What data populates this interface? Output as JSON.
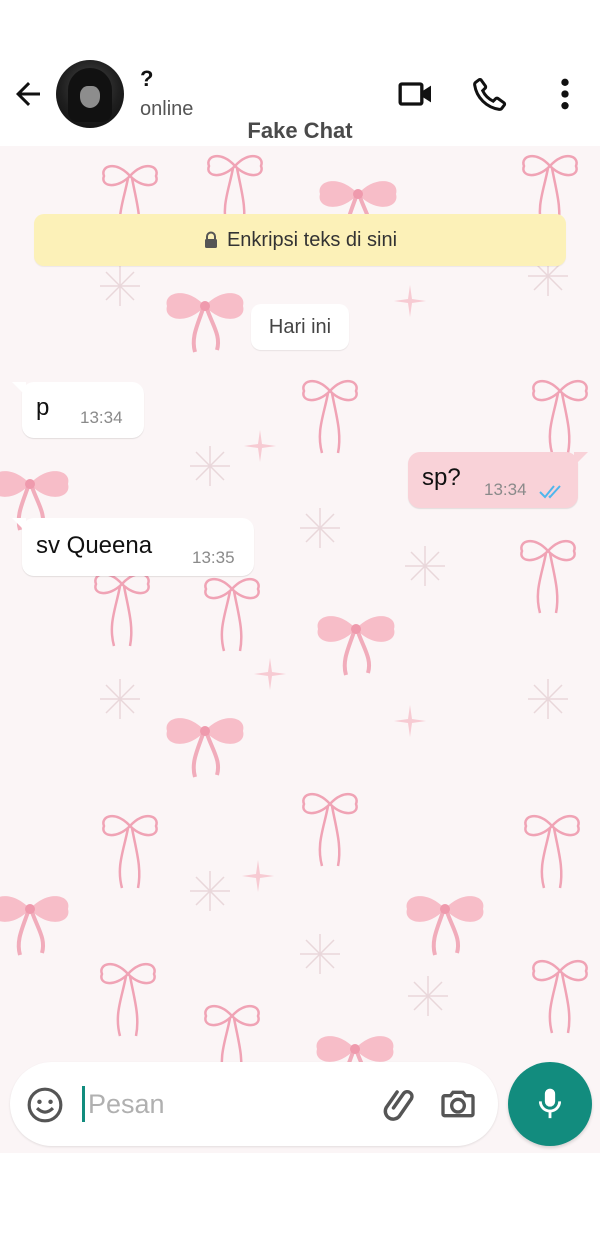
{
  "header": {
    "contact_name": "?",
    "contact_status": "online",
    "app_title": "Fake Chat",
    "icons": [
      "back-arrow-icon",
      "video-call-icon",
      "voice-call-icon",
      "more-options-icon"
    ]
  },
  "chat": {
    "encryption_notice": "Enkripsi teks di sini",
    "day_label": "Hari ini",
    "messages": [
      {
        "direction": "incoming",
        "text": "p",
        "time": "13:34"
      },
      {
        "direction": "outgoing",
        "text": "sp?",
        "time": "13:34",
        "status": "read"
      },
      {
        "direction": "incoming",
        "text": "sv Queena",
        "time": "13:35"
      }
    ]
  },
  "composer": {
    "placeholder": "Pesan",
    "value": "",
    "icons": [
      "emoji-icon",
      "attach-icon",
      "camera-icon",
      "mic-icon"
    ]
  },
  "colors": {
    "accent": "#128c7e",
    "outgoing_bubble": "#f9d2d8",
    "incoming_bubble": "#ffffff",
    "encryption_banner": "#fcf1b8",
    "read_ticks": "#4fb6ec",
    "wallpaper": "#fbf5f6",
    "wallpaper_bows": "#f4a9b8"
  }
}
